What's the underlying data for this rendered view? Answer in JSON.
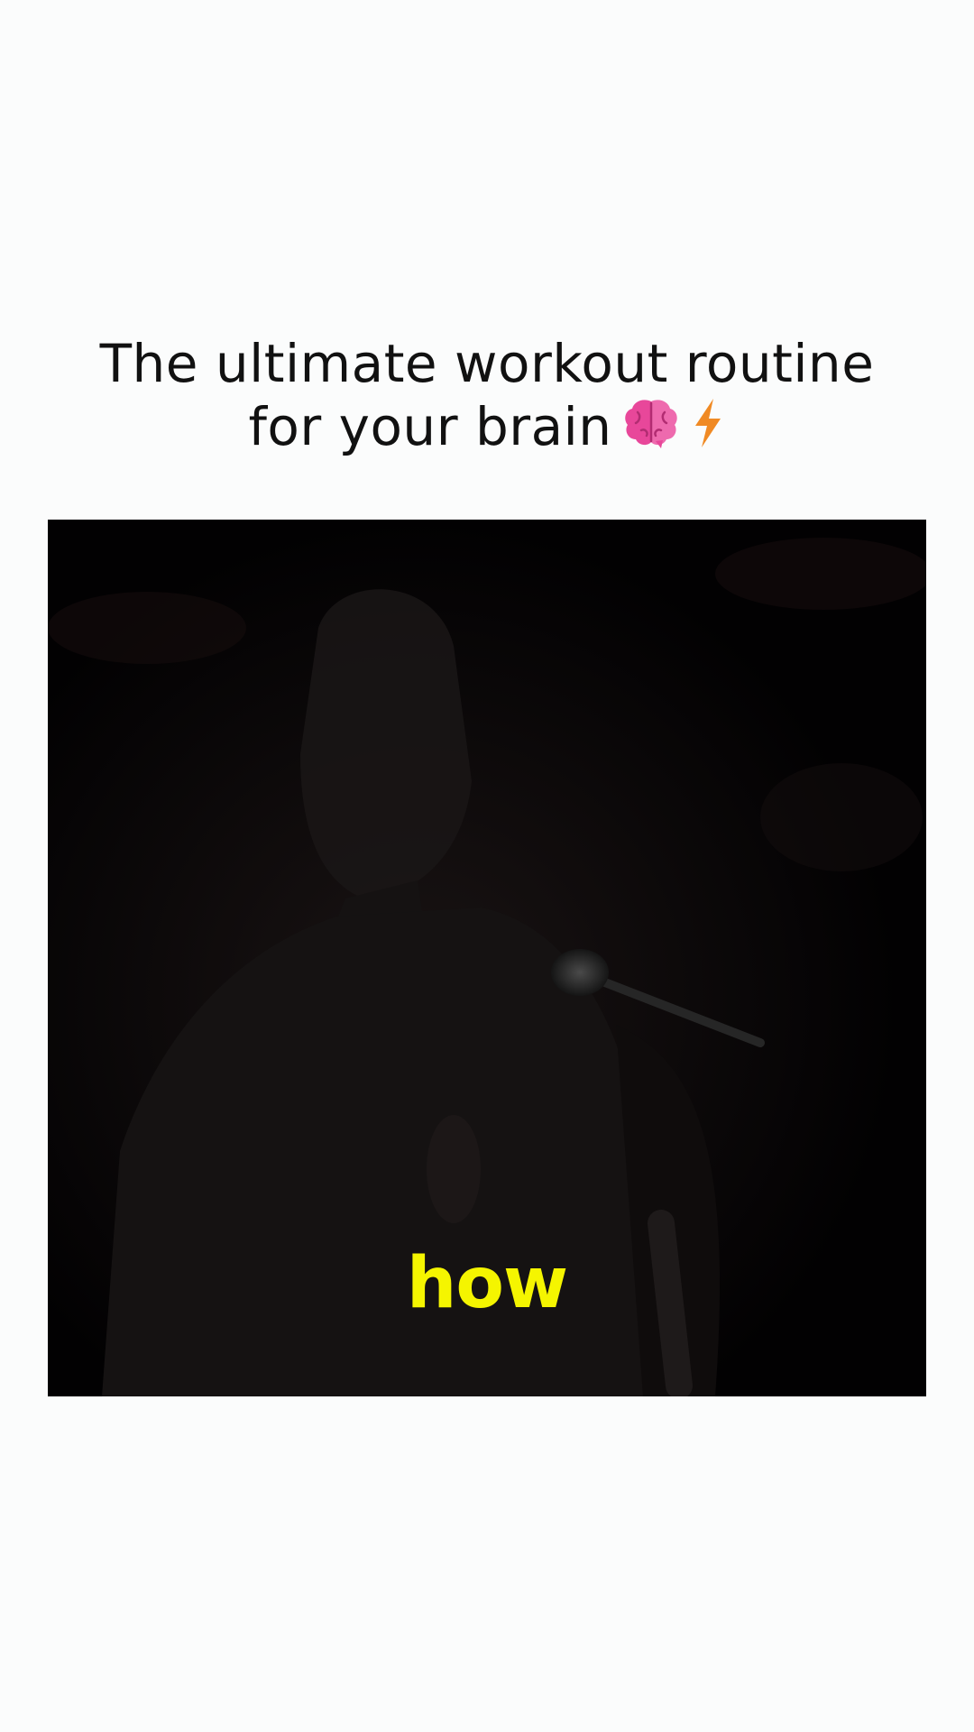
{
  "post": {
    "title_line1": "The ultimate workout routine",
    "title_line2": "for your brain",
    "title_icons": [
      "brain-icon",
      "lightning-icon"
    ]
  },
  "video": {
    "caption": "how"
  },
  "colors": {
    "background": "#fbfcfc",
    "title_text": "#111111",
    "video_background": "#020102",
    "caption_text": "#f5f500",
    "brain_icon": "#e8479a",
    "lightning_icon": "#f08a24"
  }
}
